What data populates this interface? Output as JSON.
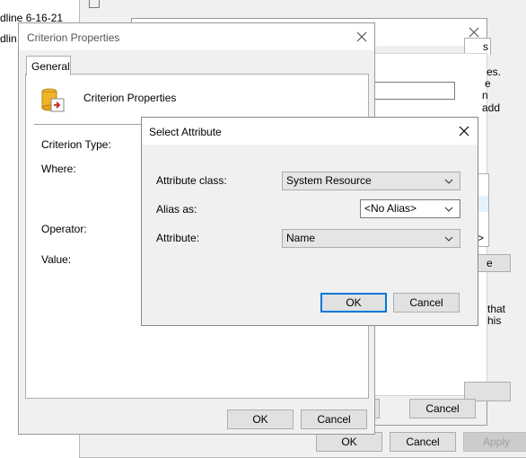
{
  "background": {
    "text_line1": "dline 6-16-21",
    "text_line2": "dlin"
  },
  "back_window": {
    "tab_fragment": "s",
    "text_fragments": [
      "es.",
      "e",
      "n add"
    ],
    "list_chevron": ">",
    "button_fragment": "e",
    "text2_fragments": [
      "that",
      "his"
    ],
    "bottom_btn_partial": ":",
    "cancel_label": "Cancel"
  },
  "main_bottom_bar": {
    "ok_label": "OK",
    "cancel_label": "Cancel",
    "apply_label": "Apply"
  },
  "criterion_dialog": {
    "title": "Criterion Properties",
    "tab_general": "General",
    "header_text": "Criterion Properties",
    "labels": {
      "criterion_type": "Criterion Type:",
      "where": "Where:",
      "operator": "Operator:",
      "value": "Value:"
    },
    "ok_label": "OK",
    "cancel_label": "Cancel"
  },
  "select_attribute_dialog": {
    "title": "Select Attribute",
    "attribute_class_label": "Attribute class:",
    "attribute_class_value": "System Resource",
    "alias_label": "Alias as:",
    "alias_value": "<No Alias>",
    "attribute_label": "Attribute:",
    "attribute_value": "Name",
    "ok_label": "OK",
    "cancel_label": "Cancel"
  },
  "colors": {
    "accent": "#0078d7",
    "dialog_bg": "#f0f0f0",
    "border": "#adadad"
  }
}
